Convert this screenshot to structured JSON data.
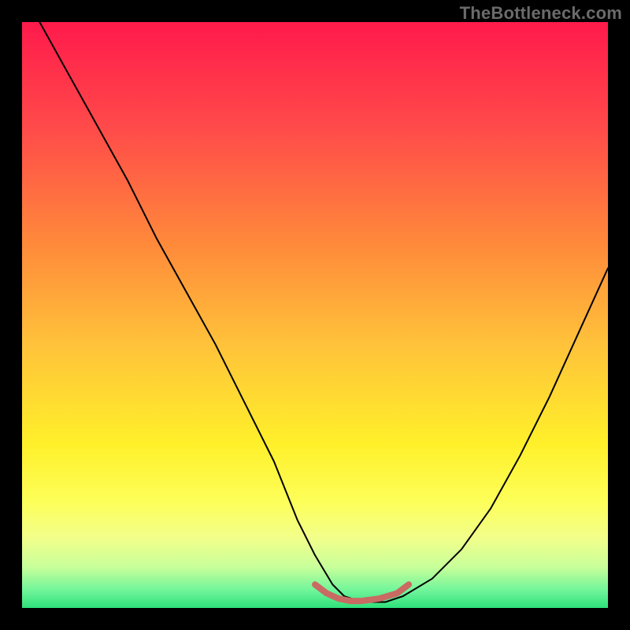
{
  "watermark": "TheBottleneck.com",
  "chart_data": {
    "type": "line",
    "title": "",
    "xlabel": "",
    "ylabel": "",
    "xlim": [
      0,
      100
    ],
    "ylim": [
      0,
      100
    ],
    "grid": false,
    "legend": false,
    "series": [
      {
        "name": "bottleneck-curve",
        "color": "#000000",
        "stroke_width": 2,
        "x": [
          3,
          8,
          13,
          18,
          23,
          28,
          33,
          38,
          43,
          47,
          50,
          53,
          55,
          58,
          62,
          65,
          70,
          75,
          80,
          85,
          90,
          95,
          100
        ],
        "y": [
          100,
          91,
          82,
          73,
          63,
          54,
          45,
          35,
          25,
          15,
          9,
          4,
          2,
          1,
          1,
          2,
          5,
          10,
          17,
          26,
          36,
          47,
          58
        ]
      },
      {
        "name": "optimal-zone-marker",
        "color": "#c96a63",
        "stroke_width": 8,
        "x": [
          50,
          52,
          54,
          56,
          58,
          61,
          64,
          66
        ],
        "y": [
          4.0,
          2.5,
          1.6,
          1.2,
          1.2,
          1.6,
          2.5,
          4.0
        ]
      }
    ],
    "background_gradient_stops": [
      {
        "offset": 0.0,
        "color": "#ff1a4b"
      },
      {
        "offset": 0.18,
        "color": "#ff4a4a"
      },
      {
        "offset": 0.38,
        "color": "#ff8a3a"
      },
      {
        "offset": 0.55,
        "color": "#ffc23a"
      },
      {
        "offset": 0.72,
        "color": "#fff02a"
      },
      {
        "offset": 0.82,
        "color": "#fdff5a"
      },
      {
        "offset": 0.88,
        "color": "#f2ff8a"
      },
      {
        "offset": 0.93,
        "color": "#c8ff9a"
      },
      {
        "offset": 0.97,
        "color": "#70f59a"
      },
      {
        "offset": 1.0,
        "color": "#2de07a"
      }
    ]
  }
}
